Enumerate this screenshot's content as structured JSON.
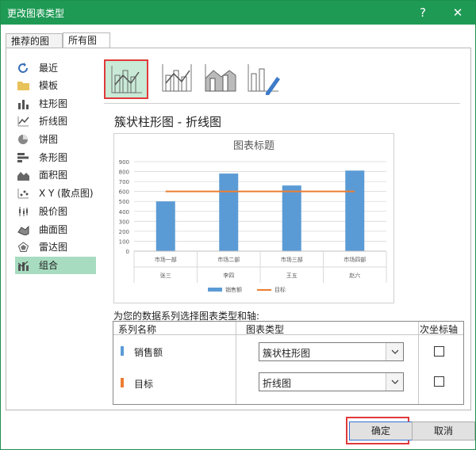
{
  "window": {
    "title": "更改图表类型",
    "help": "?",
    "close": "✕"
  },
  "tabs": [
    {
      "label": "推荐的图表",
      "active": false
    },
    {
      "label": "所有图表",
      "active": true
    }
  ],
  "sidebar": {
    "items": [
      {
        "label": "最近",
        "icon": "recent-icon"
      },
      {
        "label": "模板",
        "icon": "folder-icon"
      },
      {
        "label": "柱形图",
        "icon": "column-chart-icon"
      },
      {
        "label": "折线图",
        "icon": "line-chart-icon"
      },
      {
        "label": "饼图",
        "icon": "pie-chart-icon"
      },
      {
        "label": "条形图",
        "icon": "bar-chart-icon"
      },
      {
        "label": "面积图",
        "icon": "area-chart-icon"
      },
      {
        "label": "X Y (散点图)",
        "icon": "scatter-chart-icon"
      },
      {
        "label": "股价图",
        "icon": "stock-chart-icon"
      },
      {
        "label": "曲面图",
        "icon": "surface-chart-icon"
      },
      {
        "label": "雷达图",
        "icon": "radar-chart-icon"
      },
      {
        "label": "组合",
        "icon": "combo-chart-icon",
        "selected": true
      }
    ]
  },
  "combo_types": [
    {
      "icon": "clustered-column-line-icon",
      "selected": true
    },
    {
      "icon": "clustered-column-line-secondary-icon",
      "selected": false
    },
    {
      "icon": "stacked-area-clustered-column-icon",
      "selected": false
    },
    {
      "icon": "custom-combo-icon",
      "selected": false
    }
  ],
  "preview": {
    "heading": "簇状柱形图 - 折线图",
    "chart_title": "图表标题"
  },
  "chart_data": {
    "type": "bar",
    "title": "图表标题",
    "categories": [
      [
        "市场一部",
        "张三"
      ],
      [
        "市场二部",
        "李四"
      ],
      [
        "市场三部",
        "王五"
      ],
      [
        "市场四部",
        "赵六"
      ]
    ],
    "series": [
      {
        "name": "销售额",
        "type": "bar",
        "color": "#5b9bd5",
        "values": [
          500,
          780,
          660,
          810
        ]
      },
      {
        "name": "目标",
        "type": "line",
        "color": "#ed7d31",
        "values": [
          600,
          600,
          600,
          600
        ]
      }
    ],
    "yticks": [
      "0",
      "100",
      "200",
      "300",
      "400",
      "500",
      "600",
      "700",
      "800",
      "900"
    ],
    "ylim": [
      0,
      900
    ],
    "grid": true,
    "legend": "bottom"
  },
  "series_section": {
    "label": "为您的数据系列选择图表类型和轴:",
    "columns": {
      "name": "系列名称",
      "type": "图表类型",
      "secondary": "次坐标轴"
    },
    "rows": [
      {
        "name": "销售额",
        "color": "#5b9bd5",
        "chart_type": "簇状柱形图",
        "secondary": false
      },
      {
        "name": "目标",
        "color": "#ed7d31",
        "chart_type": "折线图",
        "secondary": false
      }
    ]
  },
  "buttons": {
    "ok": "确定",
    "cancel": "取消"
  }
}
